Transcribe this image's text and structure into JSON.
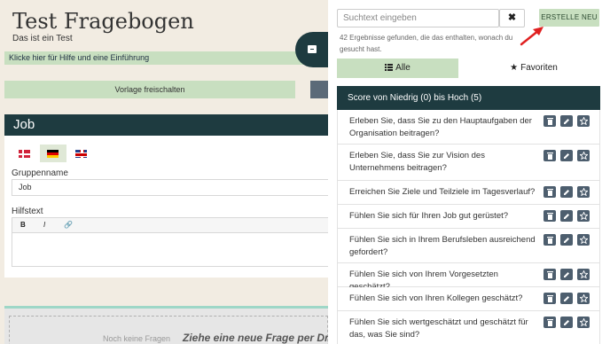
{
  "editor": {
    "title": "Test Fragebogen",
    "subtitle": "Das ist ein Test",
    "help_link": "Klicke hier für Hilfe und eine Einführung",
    "unlock_template": "Vorlage freischalten",
    "section_title": "Job",
    "languages": [
      "dk-flag-icon",
      "de-flag-icon",
      "gb-flag-icon"
    ],
    "group_name_label": "Gruppenname",
    "group_name_value": "Job",
    "help_text_label": "Hilfstext",
    "toolbar": {
      "bold": "B",
      "italic": "I",
      "link": "🔗"
    },
    "dropzone_hint": "Noch keine Fragen",
    "dropzone_text": "Ziehe eine neue Frage per Dra"
  },
  "panel": {
    "search_placeholder": "Suchtext eingeben",
    "clear_label": "✖",
    "create_label": "ERSTELLE NEU",
    "result_info": "42 Ergebnisse gefunden, die das enthalten, wonach du gesucht hast.",
    "tabs": [
      {
        "label": "Alle",
        "icon": "list-icon",
        "active": true
      },
      {
        "label": "Favoriten",
        "icon": "star-icon",
        "active": false
      }
    ],
    "list_header": "Score von Niedrig (0) bis Hoch (5)",
    "questions": [
      "Erleben Sie, dass Sie zu den Hauptaufgaben der Organisation beitragen?",
      "Erleben Sie, dass Sie zur Vision des Unternehmens beitragen?",
      "Erreichen Sie Ziele und Teilziele im Tagesverlauf?",
      "Fühlen Sie sich für Ihren Job gut gerüstet?",
      "Fühlen Sie sich in Ihrem Berufsleben ausreichend gefordert?",
      "Fühlen Sie sich von Ihrem Vorgesetzten geschätzt?",
      "Fühlen Sie sich von Ihren Kollegen geschätzt?",
      "Fühlen Sie sich wertgeschätzt und geschätzt für das, was Sie sind?"
    ],
    "row_icons": {
      "delete": "trash-icon",
      "edit": "pencil-icon",
      "favorite": "star-icon"
    }
  },
  "colors": {
    "accent_green": "#c8dfc0",
    "dark_teal": "#1e3b40",
    "icon_button": "#4d5e6e",
    "annotation_arrow": "#e02020"
  }
}
